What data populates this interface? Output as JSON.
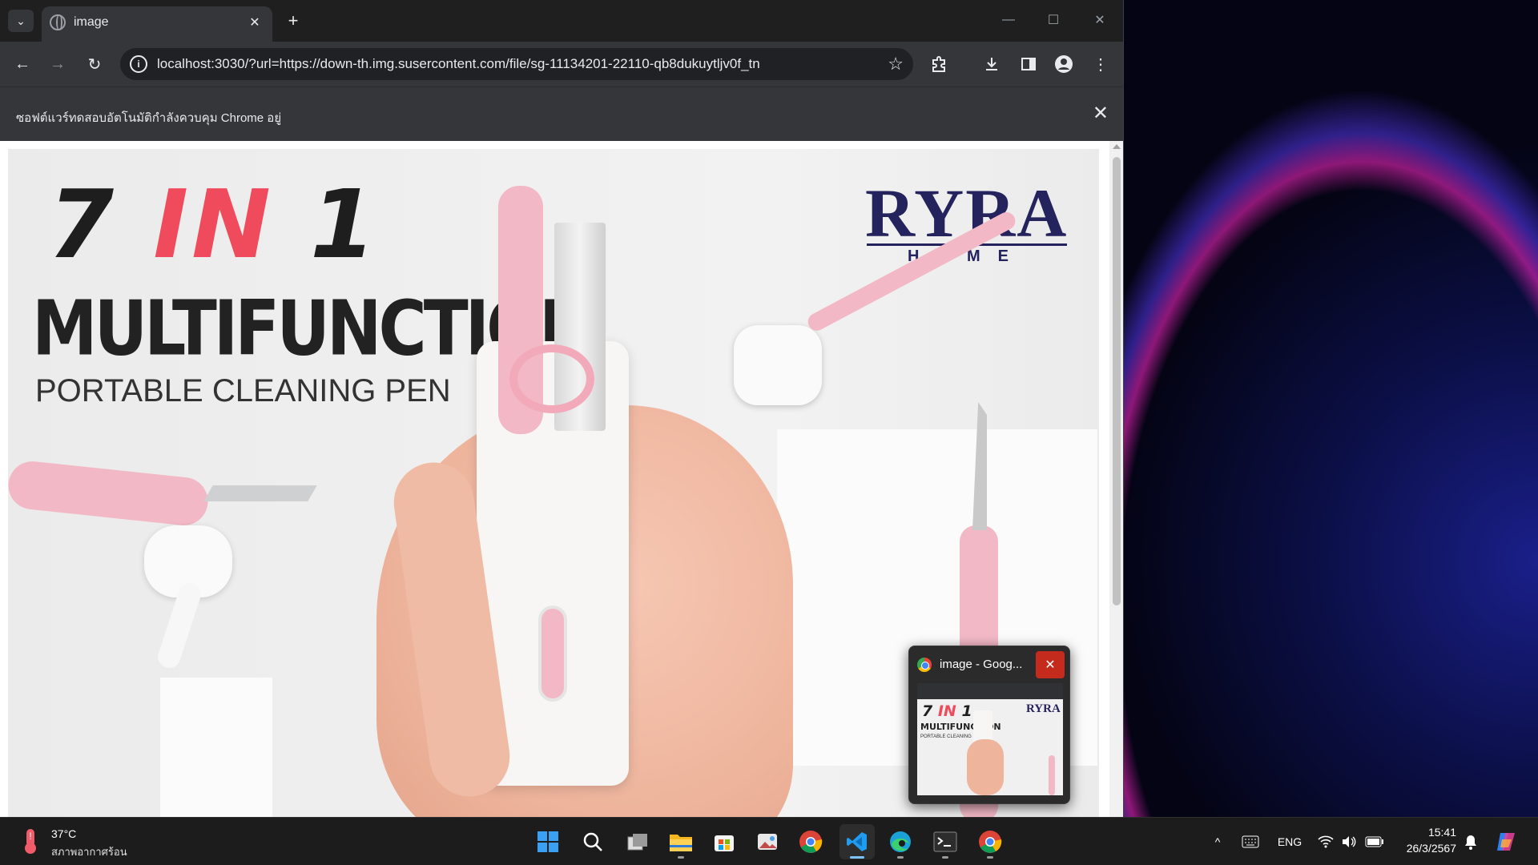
{
  "browser": {
    "tab_title": "image",
    "url": "localhost:3030/?url=https://down-th.img.susercontent.com/file/sg-11134201-22110-qb8dukuytljv0f_tn",
    "infobar_message": "ซอฟต์แวร์ทดสอบอัตโนมัติกำลังควบคุม Chrome อยู่",
    "icons": [
      "tab-search-icon",
      "close-icon",
      "plus-icon",
      "back-icon",
      "forward-icon",
      "reload-icon",
      "info-icon",
      "star-icon",
      "extensions-icon",
      "download-icon",
      "side-panel-icon",
      "profile-icon",
      "menu-icon"
    ]
  },
  "product_image": {
    "headline_part1": "7 ",
    "headline_part2": "IN",
    "headline_part3": " 1",
    "line2": "MULTIFUNCTION",
    "line3": "PORTABLE CLEANING PEN",
    "brand": "RYRA",
    "brand_sub": "HOME",
    "accent_color": "#ef4b5c",
    "brand_color": "#24235e",
    "product_color": "#f2b8c6"
  },
  "preview": {
    "title": "image - Goog...",
    "headline_part1": "7 ",
    "headline_part2": "IN",
    "headline_part3": " 1",
    "line2": "MULTIFUNCTION",
    "line3": "PORTABLE CLEANING PEN",
    "brand": "RYRA"
  },
  "taskbar": {
    "weather_temp": "37°C",
    "weather_condition": "สภาพอากาศร้อน",
    "apps": [
      "start-icon",
      "search-icon",
      "task-view-icon",
      "file-explorer-icon",
      "store-icon",
      "photos-icon",
      "chrome-icon",
      "vscode-icon",
      "edge-icon",
      "terminal-icon",
      "chrome-icon"
    ],
    "lang": "ENG",
    "time": "15:41",
    "date": "26/3/2567"
  }
}
